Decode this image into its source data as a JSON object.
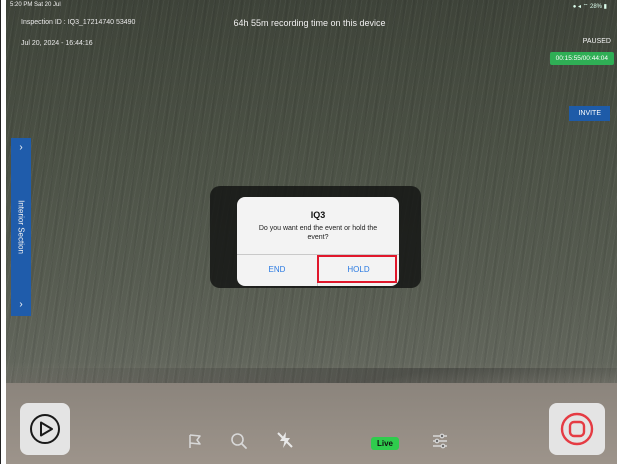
{
  "status_bar": {
    "time_date": "5:20 PM Sat 20 Jul",
    "indicators": "● ◂ ⌔ 28% ▮"
  },
  "header": {
    "inspection_id": "Inspection ID : IQ3_17214740 53490",
    "timestamp": "Jul 20, 2024 - 16:44:16",
    "recording_time": "64h 55m recording time on this device",
    "state": "PAUSED",
    "timer": "00:15:55/00:44:04",
    "invite_label": "INVITE"
  },
  "side_panel": {
    "label": "Interior Section",
    "top_chevron": "›",
    "bottom_chevron": "›"
  },
  "alert": {
    "title": "IQ3",
    "message": "Do you want end the event or hold the event?",
    "buttons": {
      "end": "END",
      "hold": "HOLD"
    }
  },
  "toolbar": {
    "live_label": "Live",
    "icons": [
      "play-icon",
      "flag-icon",
      "search-icon",
      "flash-off-icon",
      "sliders-icon",
      "stop-record-icon"
    ]
  },
  "colors": {
    "highlight": "#e0172b",
    "accent_blue": "#1f5cab",
    "accent_green": "#2fae55",
    "live_green": "#2fcc4d",
    "ios_blue": "#2a7ae2"
  }
}
